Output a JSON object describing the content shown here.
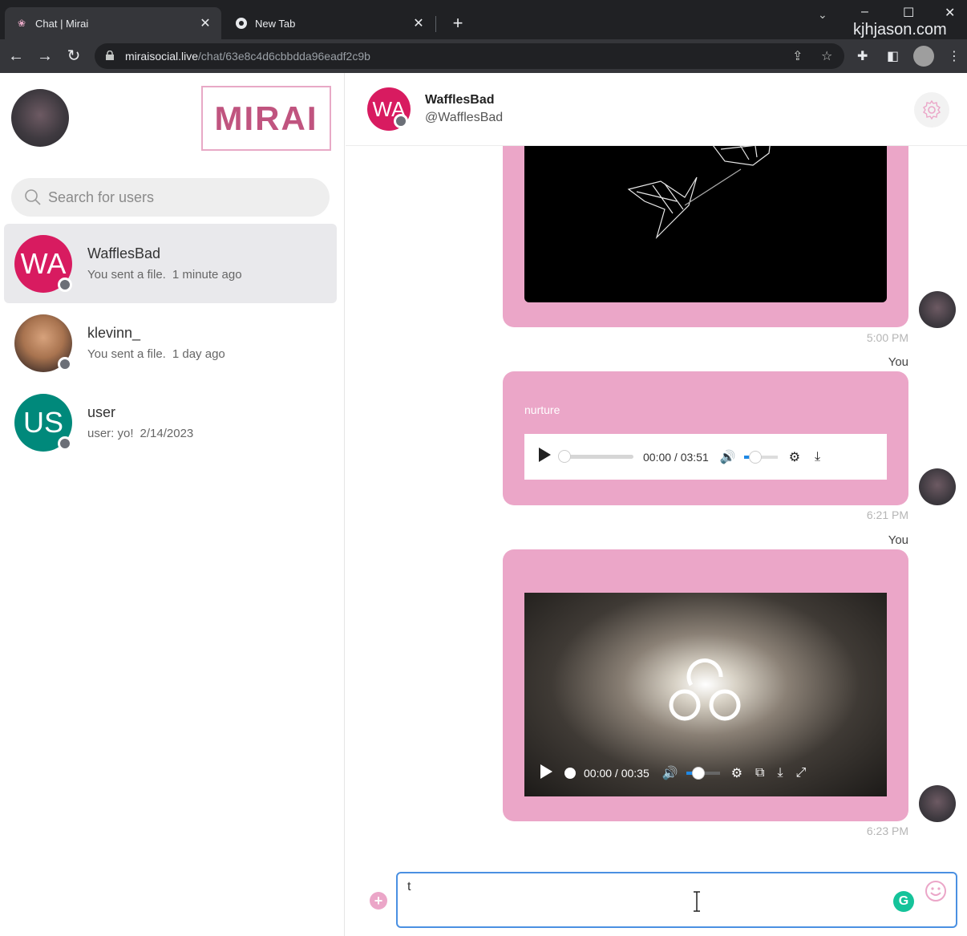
{
  "browser": {
    "tabs": [
      {
        "title": "Chat | Mirai",
        "active": true
      },
      {
        "title": "New Tab",
        "active": false
      }
    ],
    "url_host": "miraisocial.live",
    "url_path": "/chat/63e8c4d6cbbdda96eadf2c9b",
    "watermark": "kjhjason.com",
    "window_controls": [
      "–",
      "☐",
      "✕"
    ]
  },
  "sidebar": {
    "logo": "MIRAI",
    "search_placeholder": "Search for users",
    "conversations": [
      {
        "initials": "WA",
        "name": "WafflesBad",
        "preview": "You sent a file.",
        "time": "1 minute ago",
        "avatar_color": "#d81b60",
        "active": true
      },
      {
        "initials": "",
        "name": "klevinn_",
        "preview": "You sent a file.",
        "time": "1 day ago",
        "avatar_color": "#8b6a52",
        "active": false
      },
      {
        "initials": "US",
        "name": "user",
        "preview": "user: yo!",
        "time": "2/14/2023",
        "avatar_color": "#00897b",
        "active": false
      }
    ]
  },
  "chat": {
    "header": {
      "initials": "WA",
      "name": "WafflesBad",
      "handle": "@WafflesBad",
      "avatar_color": "#d81b60"
    },
    "messages": [
      {
        "type": "video",
        "time": "5:00 PM"
      },
      {
        "type": "audio",
        "sender": "You",
        "title": "nurture",
        "current": "00:00",
        "duration": "03:51",
        "volume": 0.3,
        "time": "6:21 PM"
      },
      {
        "type": "video",
        "sender": "You",
        "current": "00:00",
        "duration": "00:35",
        "volume": 0.35,
        "time": "6:23 PM"
      }
    ],
    "composer": {
      "value": "t",
      "placeholder": ""
    },
    "accent": "#eba6c8"
  }
}
